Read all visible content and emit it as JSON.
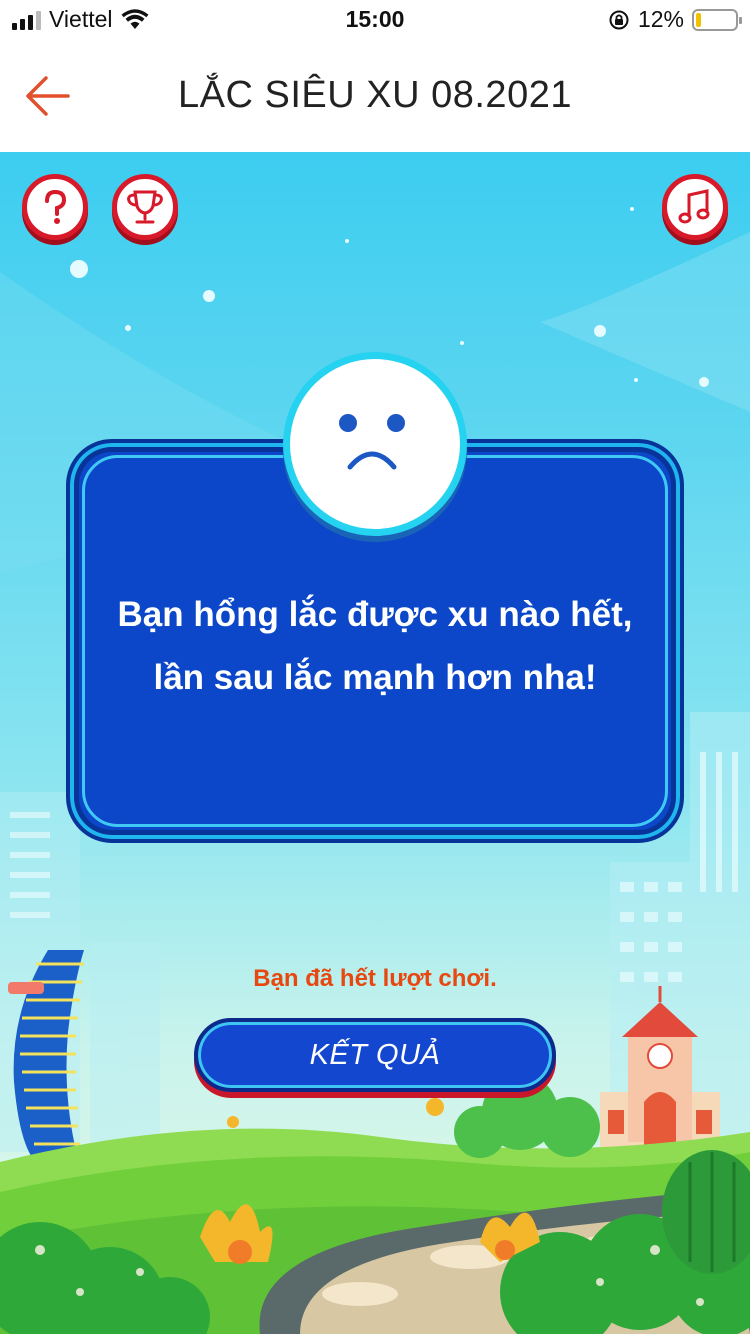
{
  "status_bar": {
    "carrier": "Viettel",
    "time": "15:00",
    "battery_percent": "12%",
    "battery_level": 0.12
  },
  "nav": {
    "title": "LẮC SIÊU XU 08.2021",
    "back_icon": "arrow-left-icon",
    "accent_color": "#e2502e"
  },
  "game": {
    "toolbar": {
      "help_icon": "question-icon",
      "leaderboard_icon": "trophy-icon",
      "music_icon": "music-note-icon"
    },
    "dialog": {
      "face_icon": "sad-face-icon",
      "message_line1": "Bạn hổng lắc được xu nào hết,",
      "message_line2": "lần sau lắc mạnh hơn nha!"
    },
    "status_message": "Bạn đã hết lượt chơi.",
    "result_button": "KẾT QUẢ",
    "colors": {
      "dialog_bg": "#0b47c8",
      "dialog_border": "#41c9f5",
      "button_red": "#d8192a",
      "status_text": "#e8480f"
    }
  }
}
